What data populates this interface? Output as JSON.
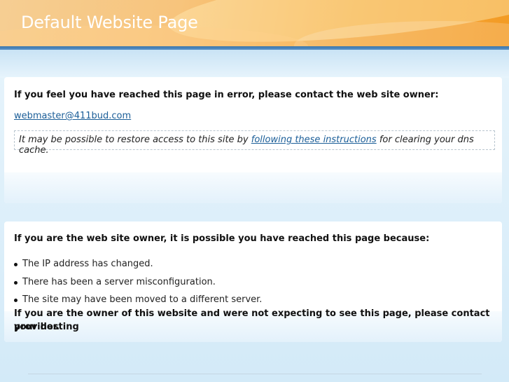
{
  "header": {
    "title": "Default Website Page"
  },
  "error_panel": {
    "heading": "If you feel you have reached this page in error, please contact the web site owner:",
    "email": "webmaster@411bud.com",
    "dns_note_before": "It may be possible to restore access to this site by ",
    "dns_note_link": "following these instructions",
    "dns_note_after": " for clearing your dns cache."
  },
  "owner_panel": {
    "heading": "If you are the web site owner, it is possible you have reached this page because:",
    "reasons": [
      "The IP address has changed.",
      "There has been a server misconfiguration.",
      "The site may have been moved to a different server."
    ],
    "closing_line1": "If you are the owner of this website and were not expecting to see this page, please contact your hosting",
    "closing_line2": "provider."
  },
  "colors": {
    "banner_orange": "#f39b24",
    "rule_blue": "#3a76ad",
    "link_blue": "#1b5e98"
  }
}
